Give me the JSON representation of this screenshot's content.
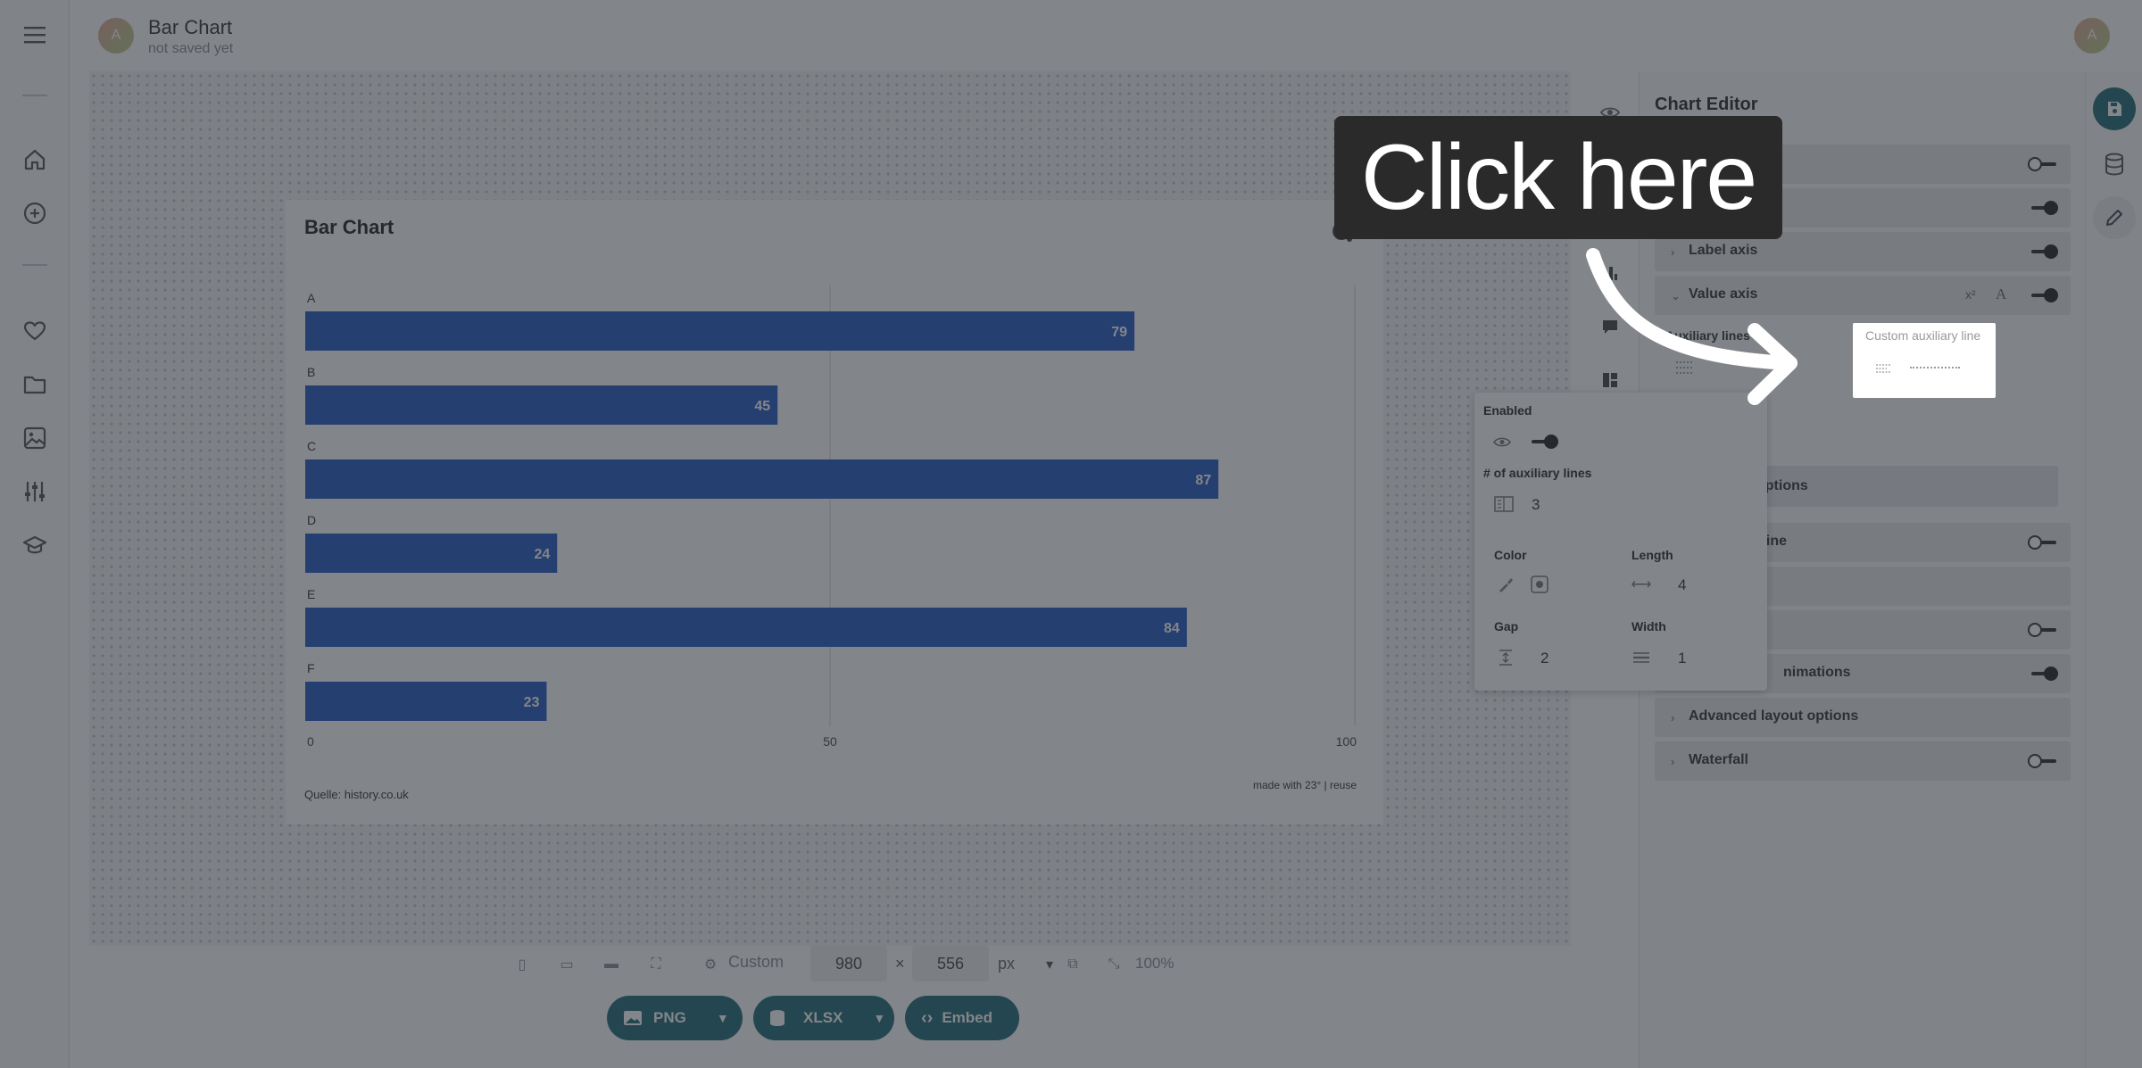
{
  "app": {
    "user_initial": "A",
    "document_title": "Bar Chart",
    "document_status": "not saved yet"
  },
  "left_rail": {
    "items": [
      "menu-icon",
      "home-icon",
      "add-icon",
      "heart-icon",
      "folder-icon",
      "image-icon",
      "sliders-icon",
      "graduation-cap-icon"
    ]
  },
  "chart": {
    "title": "Bar Chart",
    "source": "Quelle: history.co.uk",
    "credit": "made with 23° | reuse"
  },
  "chart_data": {
    "type": "bar",
    "orientation": "horizontal",
    "title": "Bar Chart",
    "categories": [
      "A",
      "B",
      "C",
      "D",
      "E",
      "F"
    ],
    "values": [
      79,
      45,
      87,
      24,
      84,
      23
    ],
    "xlim": [
      0,
      100
    ],
    "x_ticks": [
      "0",
      "50",
      "100"
    ],
    "bar_color": "#2458c6",
    "data_labels": true,
    "grid": true
  },
  "canvas_tools": [
    "eye-icon",
    "brush-icon",
    "bar-chart-icon",
    "comment-icon",
    "layout-icon"
  ],
  "editor": {
    "title": "Chart Editor",
    "rows": {
      "label_axis": "Label axis",
      "value_axis": "Value axis",
      "auxiliary_lines": "Auxiliary lines",
      "more_options_suffix": "options",
      "zero_line_suffix": "ro line",
      "animations_suffix": "nimations",
      "advanced_layout": "Advanced layout options",
      "waterfall": "Waterfall"
    },
    "value_axis_icons": [
      "x²",
      "A"
    ]
  },
  "popup": {
    "enabled_label": "Enabled",
    "count_label": "# of auxiliary lines",
    "count_value": "3",
    "color_label": "Color",
    "length_label": "Length",
    "length_value": "4",
    "gap_label": "Gap",
    "gap_value": "2",
    "width_label": "Width",
    "width_value": "1"
  },
  "bottom_toolbar": {
    "preset": "Custom",
    "width_value": "980",
    "height_value": "556",
    "times": "×",
    "unit": "px",
    "zoom": "100%"
  },
  "export": {
    "png": "PNG",
    "xlsx": "XLSX",
    "embed": "Embed"
  },
  "tutorial": {
    "callout": "Click here",
    "highlight_label": "Custom auxiliary line"
  },
  "colors": {
    "accent": "#1f6a78",
    "bar": "#2458c6",
    "save_button": "#1f6a78"
  }
}
